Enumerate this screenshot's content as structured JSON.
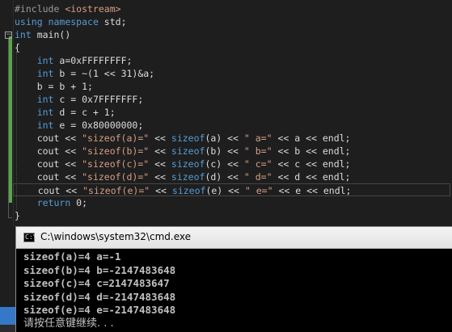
{
  "editor": {
    "lines": [
      {
        "tokens": [
          {
            "c": "t-pp",
            "t": "#include "
          },
          {
            "c": "t-str",
            "t": "<iostream>"
          }
        ]
      },
      {
        "tokens": [
          {
            "c": "t-kw",
            "t": "using"
          },
          {
            "c": "t-txt",
            "t": " "
          },
          {
            "c": "t-kw",
            "t": "namespace"
          },
          {
            "c": "t-txt",
            "t": " std;"
          }
        ]
      },
      {
        "tokens": [
          {
            "c": "t-kw",
            "t": "int"
          },
          {
            "c": "t-txt",
            "t": " main()"
          }
        ]
      },
      {
        "tokens": [
          {
            "c": "t-txt",
            "t": "{"
          }
        ]
      },
      {
        "tokens": [
          {
            "c": "t-txt",
            "t": "    "
          },
          {
            "c": "t-kw",
            "t": "int"
          },
          {
            "c": "t-txt",
            "t": " a=0xFFFFFFFF;"
          }
        ]
      },
      {
        "tokens": [
          {
            "c": "t-txt",
            "t": "    "
          },
          {
            "c": "t-kw",
            "t": "int"
          },
          {
            "c": "t-txt",
            "t": " b = ~(1 << 31)&a;"
          }
        ]
      },
      {
        "tokens": [
          {
            "c": "t-txt",
            "t": "    b = b + 1;"
          }
        ]
      },
      {
        "tokens": [
          {
            "c": "t-txt",
            "t": "    "
          },
          {
            "c": "t-kw",
            "t": "int"
          },
          {
            "c": "t-txt",
            "t": " c = 0x7FFFFFFF;"
          }
        ]
      },
      {
        "tokens": [
          {
            "c": "t-txt",
            "t": "    "
          },
          {
            "c": "t-kw",
            "t": "int"
          },
          {
            "c": "t-txt",
            "t": " d = c + 1;"
          }
        ]
      },
      {
        "tokens": [
          {
            "c": "t-txt",
            "t": "    "
          },
          {
            "c": "t-kw",
            "t": "int"
          },
          {
            "c": "t-txt",
            "t": " e = 0x80000000;"
          }
        ]
      },
      {
        "tokens": [
          {
            "c": "t-txt",
            "t": "    cout << "
          },
          {
            "c": "t-str",
            "t": "\"sizeof(a)=\""
          },
          {
            "c": "t-txt",
            "t": " << "
          },
          {
            "c": "t-kw",
            "t": "sizeof"
          },
          {
            "c": "t-txt",
            "t": "(a) << "
          },
          {
            "c": "t-str",
            "t": "\" a=\""
          },
          {
            "c": "t-txt",
            "t": " << a << endl;"
          }
        ]
      },
      {
        "tokens": [
          {
            "c": "t-txt",
            "t": "    cout << "
          },
          {
            "c": "t-str",
            "t": "\"sizeof(b)=\""
          },
          {
            "c": "t-txt",
            "t": " << "
          },
          {
            "c": "t-kw",
            "t": "sizeof"
          },
          {
            "c": "t-txt",
            "t": "(b) << "
          },
          {
            "c": "t-str",
            "t": "\" b=\""
          },
          {
            "c": "t-txt",
            "t": " << b << endl;"
          }
        ]
      },
      {
        "tokens": [
          {
            "c": "t-txt",
            "t": "    cout << "
          },
          {
            "c": "t-str",
            "t": "\"sizeof(c)=\""
          },
          {
            "c": "t-txt",
            "t": " << "
          },
          {
            "c": "t-kw",
            "t": "sizeof"
          },
          {
            "c": "t-txt",
            "t": "(c) << "
          },
          {
            "c": "t-str",
            "t": "\" c=\""
          },
          {
            "c": "t-txt",
            "t": " << c << endl;"
          }
        ]
      },
      {
        "tokens": [
          {
            "c": "t-txt",
            "t": "    cout << "
          },
          {
            "c": "t-str",
            "t": "\"sizeof(d)=\""
          },
          {
            "c": "t-txt",
            "t": " << "
          },
          {
            "c": "t-kw",
            "t": "sizeof"
          },
          {
            "c": "t-txt",
            "t": "(d) << "
          },
          {
            "c": "t-str",
            "t": "\" d=\""
          },
          {
            "c": "t-txt",
            "t": " << d << endl;"
          }
        ]
      },
      {
        "tokens": [
          {
            "c": "t-txt",
            "t": "    cout << "
          },
          {
            "c": "t-str",
            "t": "\"sizeof(e)=\""
          },
          {
            "c": "t-txt",
            "t": " << "
          },
          {
            "c": "t-kw",
            "t": "sizeof"
          },
          {
            "c": "t-txt",
            "t": "(e) << "
          },
          {
            "c": "t-str",
            "t": "\" e=\""
          },
          {
            "c": "t-txt",
            "t": " << e << endl;"
          }
        ]
      },
      {
        "tokens": [
          {
            "c": "t-txt",
            "t": "    "
          },
          {
            "c": "t-kw",
            "t": "return"
          },
          {
            "c": "t-txt",
            "t": " 0;"
          }
        ]
      },
      {
        "tokens": [
          {
            "c": "t-txt",
            "t": "}"
          }
        ]
      }
    ],
    "current_line": 14,
    "collapse_glyph": "−"
  },
  "console": {
    "icon_glyph": "C:\\",
    "title": "C:\\windows\\system32\\cmd.exe",
    "lines": [
      "sizeof(a)=4 a=-1",
      "sizeof(b)=4 b=-2147483648",
      "sizeof(c)=4 c=2147483647",
      "sizeof(d)=4 d=-2147483648",
      "sizeof(e)=4 e=-2147483648"
    ],
    "prompt": "请按任意键继续. . ."
  }
}
